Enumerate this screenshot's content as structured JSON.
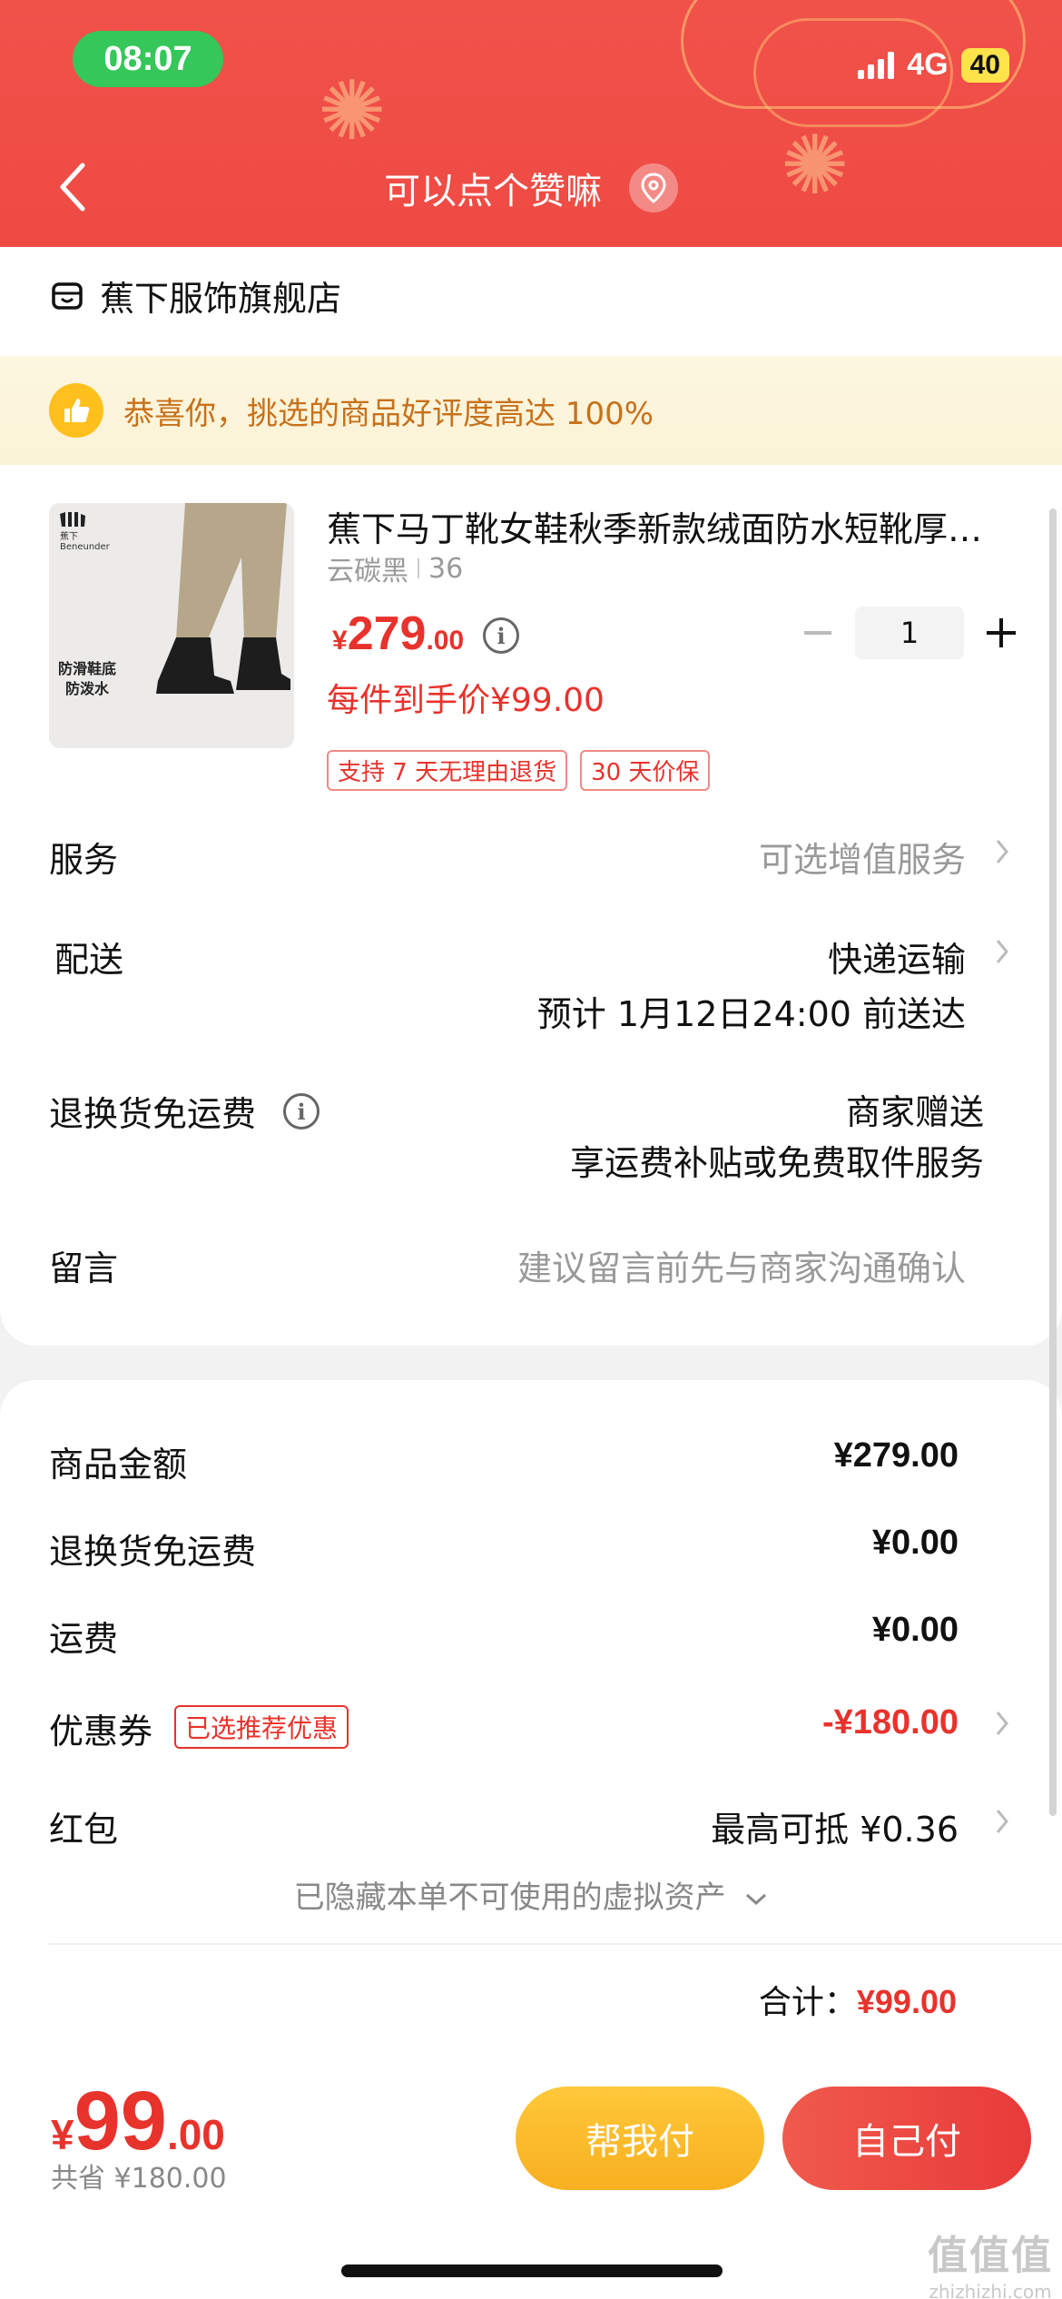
{
  "status_bar": {
    "time": "08:07",
    "network": "4G",
    "battery": "40"
  },
  "nav": {
    "title": "可以点个赞嘛",
    "icons": [
      "back-arrow-icon",
      "location-pin-icon"
    ]
  },
  "shop": {
    "name": "蕉下服饰旗舰店",
    "icon": "store-icon"
  },
  "praise_banner": {
    "text": "恭喜你，挑选的商品好评度高达 100%",
    "icon": "thumbs-up-icon"
  },
  "product": {
    "title": "蕉下马丁靴女鞋秋季新款绒面防水短靴厚底马丁靴",
    "color": "云碳黑",
    "size": "36",
    "price_currency": "¥",
    "price_integer": "279",
    "price_decimal": ".00",
    "per_item_price": "每件到手价¥99.00",
    "quantity": "1",
    "image_caption_line1": "防滑鞋底",
    "image_caption_line2": "防泼水",
    "image_brand": "蕉下 Beneunder",
    "tags": [
      "支持 7 天无理由退货",
      "30 天价保"
    ]
  },
  "rows": {
    "service_label": "服务",
    "service_value": "可选增值服务",
    "delivery_label": "配送",
    "delivery_value": "快递运输",
    "delivery_eta": "预计 1月12日24:00 前送达",
    "return_label": "退换货免运费",
    "return_value": "商家赠送",
    "return_detail": "享运费补贴或免费取件服务",
    "message_label": "留言",
    "message_placeholder": "建议留言前先与商家沟通确认"
  },
  "summary": {
    "goods_label": "商品金额",
    "goods_value": "¥279.00",
    "return_fee_label": "退换货免运费",
    "return_fee_value": "¥0.00",
    "shipping_label": "运费",
    "shipping_value": "¥0.00",
    "coupon_label": "优惠券",
    "coupon_badge": "已选推荐优惠",
    "coupon_value": "-¥180.00",
    "redpacket_label": "红包",
    "redpacket_value": "最高可抵 ¥0.36",
    "hidden_assets": "已隐藏本单不可使用的虚拟资产",
    "total_label": "合计：",
    "total_value": "¥99.00"
  },
  "footer": {
    "pay_currency": "¥",
    "pay_integer": "99",
    "pay_decimal": ".00",
    "savings": "共省 ¥180.00",
    "help_pay_label": "帮我付",
    "self_pay_label": "自己付"
  },
  "watermark": {
    "main": "值值值",
    "sub": "zhizhizhi.com"
  },
  "colors": {
    "header_red": "#ee4a43",
    "price_red": "#e8322c",
    "praise_orange": "#c8711a",
    "help_button": "#f7b020",
    "self_button": "#e83a3a"
  }
}
